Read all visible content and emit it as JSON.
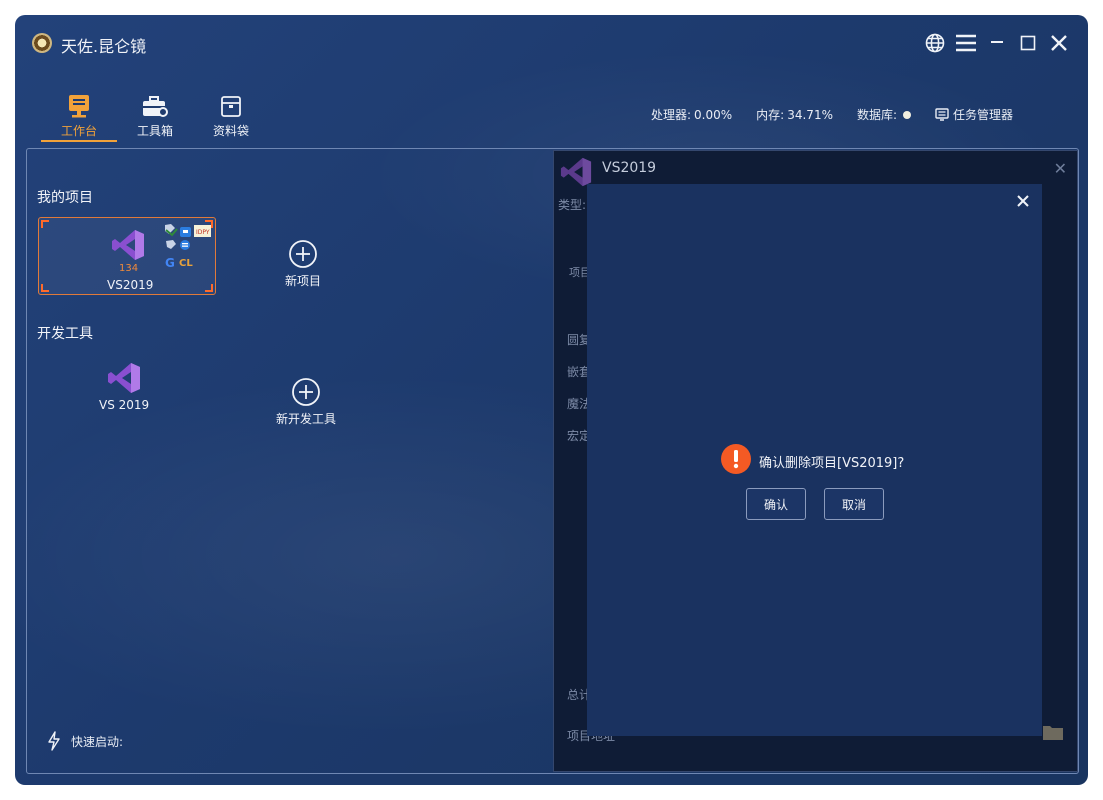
{
  "app": {
    "title": "天佐.昆仑镜"
  },
  "toolbar": {
    "items": [
      {
        "label": "工作台",
        "icon": "workbench-icon",
        "active": true
      },
      {
        "label": "工具箱",
        "icon": "toolbox-icon",
        "active": false
      },
      {
        "label": "资料袋",
        "icon": "folder-bag-icon",
        "active": false
      }
    ]
  },
  "stats": {
    "cpu_label": "处理器:",
    "cpu_value": "0.00%",
    "mem_label": "内存:",
    "mem_value": "34.71%",
    "db_label": "数据库:",
    "task_manager": "任务管理器"
  },
  "projects": {
    "section_title": "我的项目",
    "items": [
      {
        "name": "VS2019",
        "count": "134"
      }
    ],
    "new_label": "新项目"
  },
  "devtools": {
    "section_title": "开发工具",
    "items": [
      {
        "name": "VS 2019"
      }
    ],
    "new_label": "新开发工具"
  },
  "quick_launch": {
    "label": "快速启动:"
  },
  "detail": {
    "title": "VS2019",
    "type_label": "类型:",
    "tab_fragment": "项目",
    "list_fragments": [
      "圆复",
      "嵌套",
      "魔法",
      "宏定"
    ],
    "footer_total": "总计",
    "footer_path": "项目地址"
  },
  "dialog": {
    "message": "确认删除项目[VS2019]?",
    "ok_label": "确认",
    "cancel_label": "取消"
  },
  "colors": {
    "accent": "#f2a23a",
    "bg": "#1f3b6e",
    "dialog_bg": "#1a3260",
    "warning": "#f45a24",
    "vs_purple": "#8a4fd0"
  }
}
